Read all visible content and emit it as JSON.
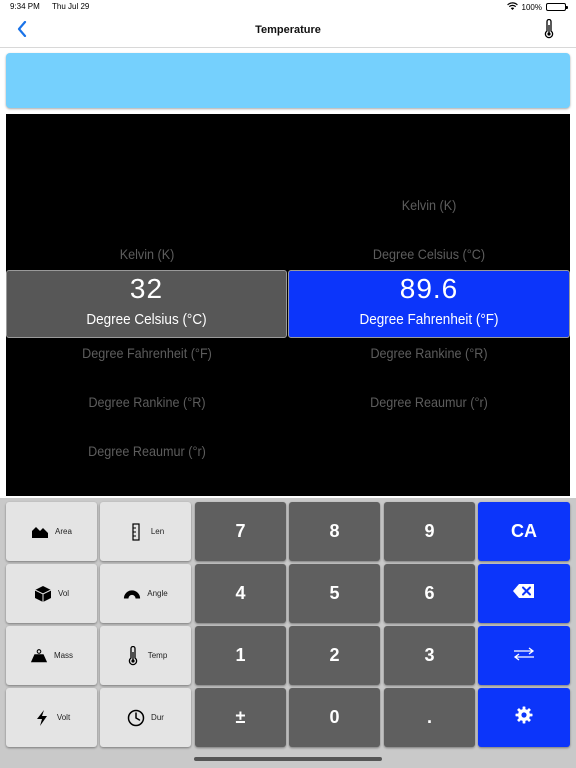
{
  "status_bar": {
    "time": "9:34 PM",
    "date": "Thu Jul 29",
    "battery": "100%"
  },
  "nav": {
    "title": "Temperature",
    "back_icon": "chevron-left-icon",
    "right_icon": "thermometer-icon"
  },
  "input_display": {
    "value": ""
  },
  "units_panel": {
    "list_left": [
      "Kelvin (K)",
      "Degree Fahrenheit (°F)",
      "Degree Rankine (°R)",
      "Degree Reaumur (°r)"
    ],
    "list_right": [
      "Kelvin (K)",
      "Degree Celsius (°C)",
      "Degree Rankine (°R)",
      "Degree Reaumur (°r)"
    ],
    "selected_from": {
      "value": "32",
      "unit": "Degree Celsius (°C)"
    },
    "selected_to": {
      "value": "89.6",
      "unit": "Degree Fahrenheit (°F)"
    }
  },
  "categories": [
    {
      "label": "Area",
      "icon": "area-icon"
    },
    {
      "label": "Len",
      "icon": "ruler-icon"
    },
    {
      "label": "Vol",
      "icon": "cube-icon"
    },
    {
      "label": "Angle",
      "icon": "protractor-icon"
    },
    {
      "label": "Mass",
      "icon": "weight-icon"
    },
    {
      "label": "Temp",
      "icon": "thermometer-icon"
    },
    {
      "label": "Volt",
      "icon": "lightning-icon"
    },
    {
      "label": "Dur",
      "icon": "clock-icon"
    }
  ],
  "keypad": {
    "digits": [
      "7",
      "8",
      "9",
      "4",
      "5",
      "6",
      "1",
      "2",
      "3",
      "±",
      "0",
      "."
    ],
    "clear_all": "CA",
    "backspace_icon": "backspace-icon",
    "swap_icon": "swap-arrows-icon",
    "settings_icon": "gear-icon"
  },
  "colors": {
    "accent": "#0c35fa",
    "display": "#75d0fd",
    "panel": "#000000",
    "key_dark": "#5f5f5f",
    "key_light": "#e4e4e4"
  }
}
